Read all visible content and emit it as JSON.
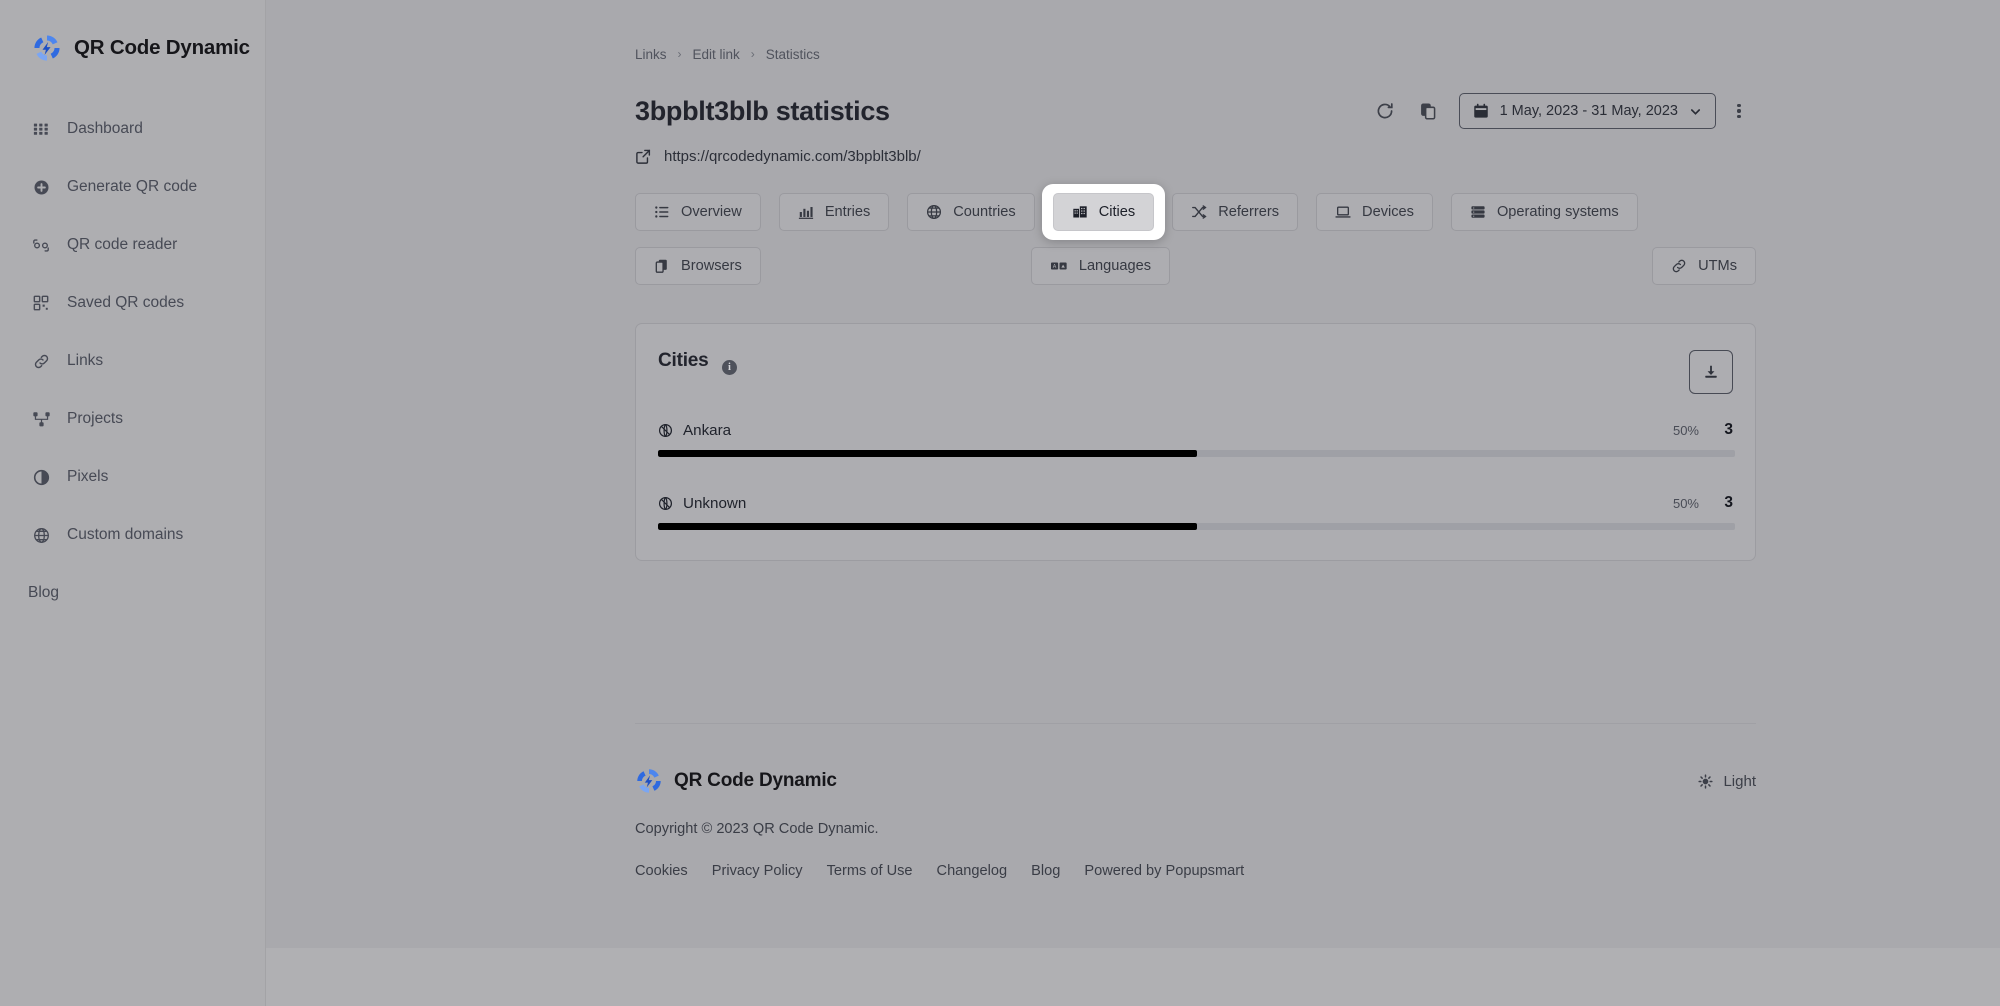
{
  "brand": {
    "name": "QR Code Dynamic"
  },
  "sidebar": {
    "items": [
      {
        "label": "Dashboard",
        "icon": "grid-icon"
      },
      {
        "label": "Generate QR code",
        "icon": "plus-circle-icon"
      },
      {
        "label": "QR code reader",
        "icon": "scan-icon"
      },
      {
        "label": "Saved QR codes",
        "icon": "qr-icon"
      },
      {
        "label": "Links",
        "icon": "link-icon"
      },
      {
        "label": "Projects",
        "icon": "sitemap-icon"
      },
      {
        "label": "Pixels",
        "icon": "half-circle-icon"
      },
      {
        "label": "Custom domains",
        "icon": "globe-icon"
      }
    ],
    "blog": {
      "label": "Blog"
    }
  },
  "breadcrumb": {
    "items": [
      "Links",
      "Edit link",
      "Statistics"
    ],
    "separator": "›"
  },
  "header": {
    "title": "3bpblt3blb statistics",
    "url": "https://qrcodedynamic.com/3bpblt3blb/",
    "refresh_icon": "refresh-icon",
    "copy_icon": "copy-icon",
    "date_range": "1 May, 2023 - 31 May, 2023",
    "calendar_icon": "calendar-icon",
    "chevron_icon": "chevron-down-icon",
    "more_icon": "kebab-menu-icon"
  },
  "tabs": [
    {
      "label": "Overview",
      "icon": "list-icon",
      "active": false
    },
    {
      "label": "Entries",
      "icon": "bar-chart-icon",
      "active": false
    },
    {
      "label": "Countries",
      "icon": "globe-icon",
      "active": false
    },
    {
      "label": "Cities",
      "icon": "buildings-icon",
      "active": true
    },
    {
      "label": "Referrers",
      "icon": "shuffle-icon",
      "active": false
    },
    {
      "label": "Devices",
      "icon": "laptop-icon",
      "active": false
    },
    {
      "label": "Operating systems",
      "icon": "server-icon",
      "active": false
    },
    {
      "label": "Browsers",
      "icon": "browser-icon",
      "active": false
    },
    {
      "label": "Languages",
      "icon": "translate-icon",
      "active": false
    },
    {
      "label": "UTMs",
      "icon": "link-icon",
      "active": false
    }
  ],
  "card": {
    "title": "Cities",
    "info_icon": "info-icon",
    "download_icon": "download-icon",
    "rows": [
      {
        "icon": "globe-pin-icon",
        "label": "Ankara",
        "percent": "50%",
        "percent_value": 50,
        "count": "3"
      },
      {
        "icon": "globe-pin-icon",
        "label": "Unknown",
        "percent": "50%",
        "percent_value": 50,
        "count": "3"
      }
    ]
  },
  "footer": {
    "brand": "QR Code Dynamic",
    "copyright": "Copyright © 2023 QR Code Dynamic.",
    "theme": {
      "label": "Light",
      "icon": "sun-icon"
    },
    "links": [
      "Cookies",
      "Privacy Policy",
      "Terms of Use",
      "Changelog",
      "Blog",
      "Powered by Popupsmart"
    ]
  },
  "colors": {
    "brand_blue": "#2f6ae0",
    "bar_fill": "#000000",
    "bar_track": "#9fa0a6",
    "text_dark": "#22242d"
  }
}
